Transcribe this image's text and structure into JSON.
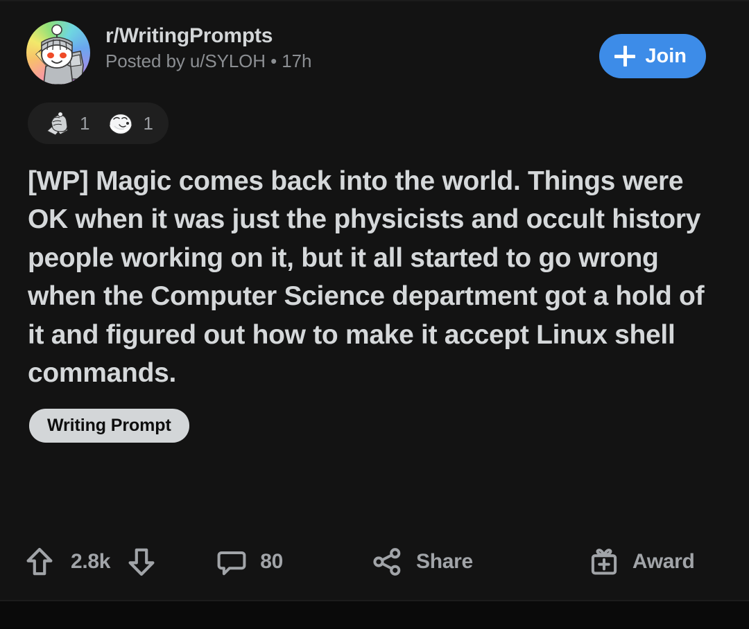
{
  "theme": {
    "background": "#080808",
    "card_background": "#131313",
    "primary_text": "#d5d8da",
    "secondary_text": "#8c8f93",
    "accent_blue": "#3d8ce8",
    "flair_background": "#d3d6d8",
    "flair_text": "#0d0d0d",
    "awards_pill_background": "#1f1f1f"
  },
  "header": {
    "avatar_icon": "snoo-knight-avatar",
    "subreddit": "r/WritingPrompts",
    "meta": "Posted by u/SYLOH • 17h",
    "author": "u/SYLOH",
    "age": "17h",
    "join_label": "Join",
    "join_icon": "plus-icon"
  },
  "awards": [
    {
      "icon": "bro-fist-award-icon",
      "count": "1"
    },
    {
      "icon": "wholesome-snoo-award-icon",
      "count": "1"
    }
  ],
  "post": {
    "title": "[WP] Magic comes back into the world. Things were OK when it was just the physicists and occult history people working on it, but it all started to go wrong when the Computer Science department got a hold of it and figured out how to make it accept Linux shell commands.",
    "flair": "Writing Prompt"
  },
  "actions": {
    "upvote_icon": "upvote-arrow-icon",
    "downvote_icon": "downvote-arrow-icon",
    "vote_count": "2.8k",
    "comment_icon": "comment-bubble-icon",
    "comment_count": "80",
    "share_icon": "share-nodes-icon",
    "share_label": "Share",
    "award_icon": "gift-award-icon",
    "award_label": "Award"
  }
}
